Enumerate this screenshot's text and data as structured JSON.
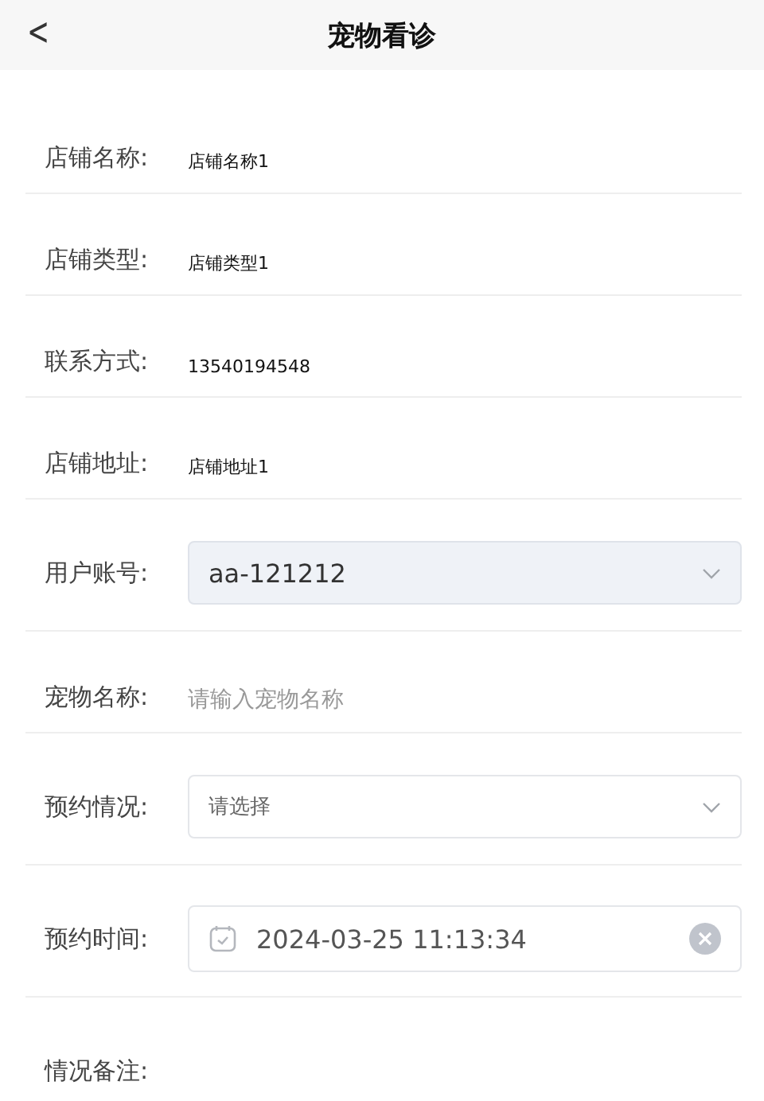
{
  "header": {
    "back": "<",
    "title": "宠物看诊"
  },
  "rows": [
    {
      "kind": "text",
      "label": "店铺名称:",
      "value": "店铺名称1"
    },
    {
      "kind": "text",
      "label": "店铺类型:",
      "value": "店铺类型1"
    },
    {
      "kind": "text",
      "label": "联系方式:",
      "value": "13540194548"
    },
    {
      "kind": "text",
      "label": "店铺地址:",
      "value": "店铺地址1"
    },
    {
      "kind": "select",
      "label": "用户账号:",
      "value": "aa-121212",
      "disabled": true
    },
    {
      "kind": "input",
      "label": "宠物名称:",
      "placeholder": "请输入宠物名称"
    },
    {
      "kind": "select",
      "label": "预约情况:",
      "placeholder": "请选择",
      "disabled": false
    },
    {
      "kind": "datetime",
      "label": "预约时间:",
      "value": "2024-03-25 11:13:34"
    },
    {
      "kind": "label",
      "label": "情况备注:"
    }
  ]
}
